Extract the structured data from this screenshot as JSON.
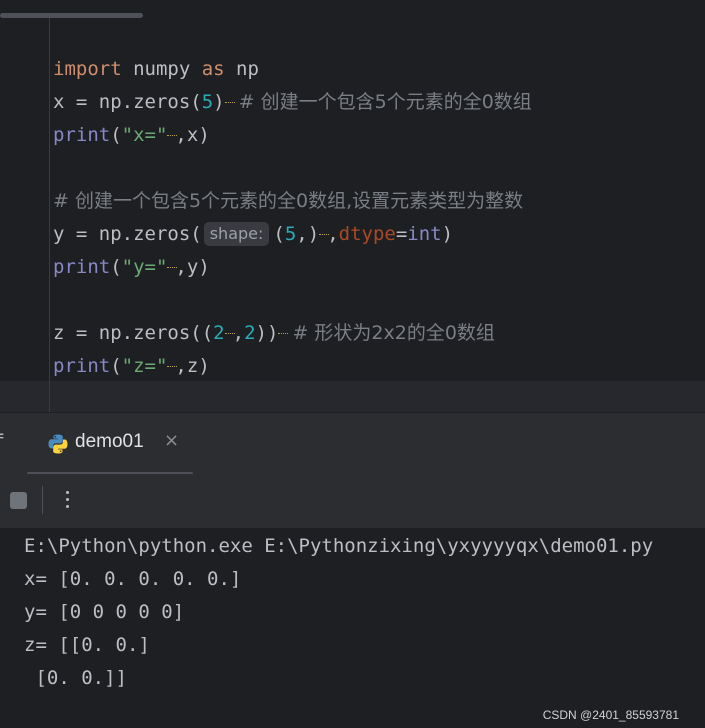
{
  "editor": {
    "line1": {
      "kw_import": "import",
      "module": " numpy ",
      "kw_as": "as",
      "alias": " np"
    },
    "line2": {
      "pre": "x = np.zeros(",
      "num": "5",
      "close": ")",
      "comment": " # 创建一个包含5个元素的全0数组"
    },
    "line3": {
      "fn": "print",
      "open": "(",
      "str": "\"x=\"",
      "comma": ",",
      "arg": "x)"
    },
    "line5": {
      "comment": "# 创建一个包含5个元素的全0数组,设置元素类型为整数"
    },
    "line6": {
      "pre": "y = np.zeros(",
      "hint": "shape:",
      "tuple_open": "(",
      "num": "5",
      "tuple_close": ",)",
      "comma": ",",
      "param": "dtype",
      "eq": "=",
      "type": "int",
      "close": ")"
    },
    "line7": {
      "fn": "print",
      "open": "(",
      "str": "\"y=\"",
      "comma": ",",
      "arg": "y)"
    },
    "line9": {
      "pre": "z = np.zeros((",
      "num1": "2",
      "comma": ",",
      "num2": "2",
      "close": "))",
      "comment": " # 形状为2x2的全0数组"
    },
    "line10": {
      "fn": "print",
      "open": "(",
      "str": "\"z=\"",
      "comma": ",",
      "arg": "z)"
    }
  },
  "run_panel": {
    "tab_left_glyph": "f",
    "tab_label": "demo01",
    "tab_icon": "python-icon",
    "close_glyph": "×",
    "stop_icon": "stop-icon",
    "more_icon": "more-vertical-icon"
  },
  "console": {
    "lines": [
      "E:\\Python\\python.exe E:\\Pythonzixing\\yxyyyyqx\\demo01.py",
      "x= [0. 0. 0. 0. 0.]",
      "y= [0 0 0 0 0]",
      "z= [[0. 0.]",
      " [0. 0.]]"
    ]
  },
  "watermark": "CSDN @2401_85593781",
  "colors": {
    "background": "#1e1f22",
    "keyword": "#cf8e6d",
    "number": "#2aacb8",
    "string": "#6aab73",
    "comment": "#7a7e85",
    "builtin": "#8888c6",
    "parameter": "#aa4926"
  }
}
